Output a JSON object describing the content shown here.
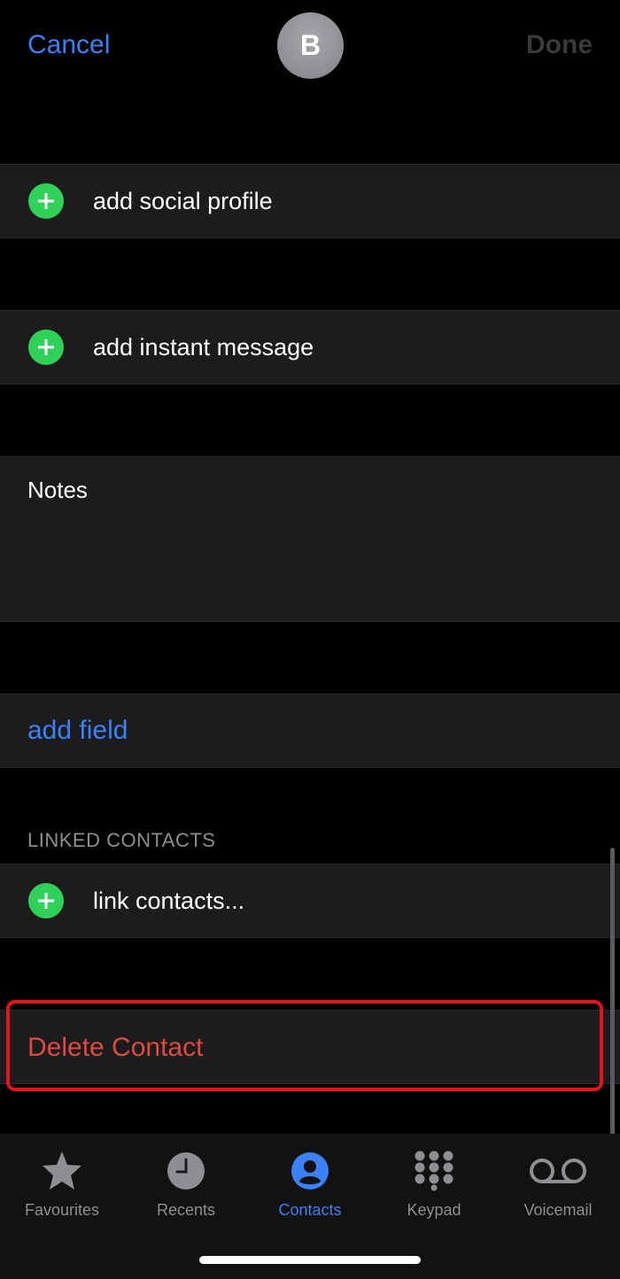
{
  "header": {
    "cancel_label": "Cancel",
    "done_label": "Done",
    "avatar_initial": "B"
  },
  "rows": {
    "social_profile": "add social profile",
    "instant_message": "add instant message",
    "notes_label": "Notes",
    "add_field": "add field",
    "linked_contacts_header": "LINKED CONTACTS",
    "link_contacts": "link contacts...",
    "delete_contact": "Delete Contact"
  },
  "tabs": [
    {
      "label": "Favourites",
      "icon": "star-icon",
      "active": false
    },
    {
      "label": "Recents",
      "icon": "clock-icon",
      "active": false
    },
    {
      "label": "Contacts",
      "icon": "person-circle-icon",
      "active": true
    },
    {
      "label": "Keypad",
      "icon": "keypad-icon",
      "active": false
    },
    {
      "label": "Voicemail",
      "icon": "voicemail-icon",
      "active": false
    }
  ],
  "colors": {
    "accent_blue": "#3b82f6",
    "add_green": "#30d158",
    "delete_red": "#e04a3f",
    "highlight_red": "#e3141c",
    "cell_bg": "#1c1c1e"
  }
}
